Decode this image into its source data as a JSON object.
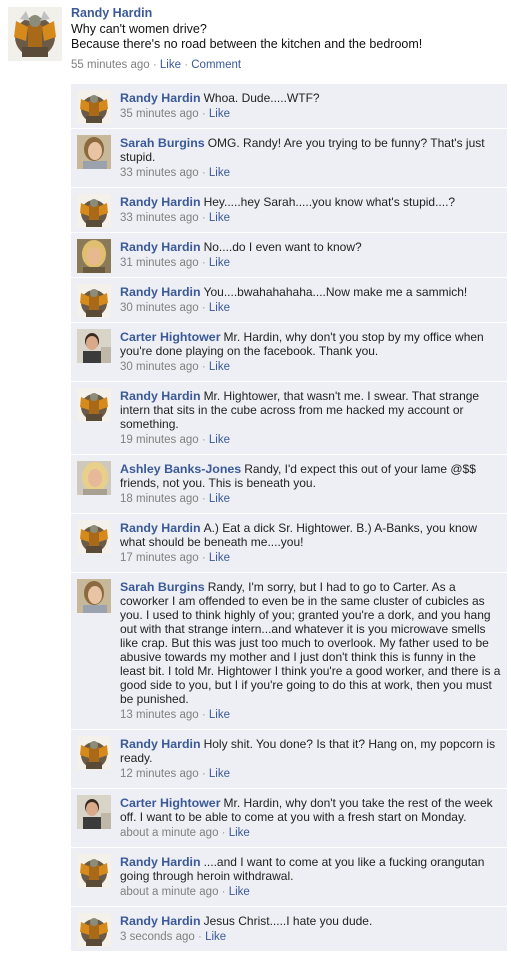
{
  "post": {
    "author": "Randy Hardin",
    "line1": "Why can't women drive?",
    "line2": "Because there's no road between the kitchen and the bedroom!",
    "time": "55 minutes ago",
    "like_label": "Like",
    "comment_label": "Comment",
    "separator": "·"
  },
  "comments": [
    {
      "author": "Randy Hardin",
      "avatar": "warrior",
      "text": "Whoa. Dude.....WTF?",
      "time": "35 minutes ago",
      "like": "Like"
    },
    {
      "author": "Sarah Burgins",
      "avatar": "sarah",
      "text": "OMG. Randy! Are you trying to be funny? That's just stupid.",
      "time": "33 minutes ago",
      "like": "Like"
    },
    {
      "author": "Randy Hardin",
      "avatar": "warrior",
      "text": "Hey.....hey Sarah.....you know what's stupid....?",
      "time": "33 minutes ago",
      "like": "Like"
    },
    {
      "author": "Randy Hardin",
      "avatar": "blonde",
      "text": "No....do I even want to know?",
      "time": "31 minutes ago",
      "like": "Like"
    },
    {
      "author": "Randy Hardin",
      "avatar": "warrior",
      "text": "You....bwahahahaha....Now make me a sammich!",
      "time": "30 minutes ago",
      "like": "Like"
    },
    {
      "author": "Carter Hightower",
      "avatar": "carter",
      "text": "Mr. Hardin, why don't you stop by my office when you're done playing on the facebook. Thank you.",
      "time": "30 minutes ago",
      "like": "Like"
    },
    {
      "author": "Randy Hardin",
      "avatar": "warrior",
      "text": "Mr. Hightower, that wasn't me. I swear. That strange intern that sits in the cube across from me hacked my account or something.",
      "time": "19 minutes ago",
      "like": "Like"
    },
    {
      "author": "Ashley Banks-Jones",
      "avatar": "ashley",
      "text": "Randy, I'd expect this out of your lame @$$ friends, not you. This is beneath you.",
      "time": "18 minutes ago",
      "like": "Like"
    },
    {
      "author": "Randy Hardin",
      "avatar": "warrior",
      "text": "A.) Eat a dick Sr. Hightower. B.) A-Banks, you know what should be beneath me....you!",
      "time": "17 minutes ago",
      "like": "Like"
    },
    {
      "author": "Sarah Burgins",
      "avatar": "sarah",
      "text": "Randy, I'm sorry, but I had to go to Carter. As a coworker I am offended to even be in the same cluster of cubicles as you. I used to think highly of you; granted you're a dork, and you hang out with that strange intern...and whatever it is you microwave smells like crap. But this was just too much to overlook. My father used to be abusive towards my mother and I just don't think this is funny in the least bit. I told Mr. Hightower I think you're a good worker, and there is a good side to you, but I if you're going to do this at work, then you must be punished.",
      "time": "13 minutes ago",
      "like": "Like"
    },
    {
      "author": "Randy Hardin",
      "avatar": "warrior",
      "text": "Holy shit. You done? Is that it? Hang on, my popcorn is ready.",
      "time": "12 minutes ago",
      "like": "Like"
    },
    {
      "author": "Carter Hightower",
      "avatar": "carter",
      "text": "Mr. Hardin, why don't you take the rest of the week off. I want to be able to come at you with a fresh start on Monday.",
      "time": "about a minute ago",
      "like": "Like"
    },
    {
      "author": "Randy Hardin",
      "avatar": "warrior",
      "text": "....and I want to come at you like a fucking orangutan going through heroin withdrawal.",
      "time": "about a minute ago",
      "like": "Like"
    },
    {
      "author": "Randy Hardin",
      "avatar": "warrior",
      "text": "Jesus Christ.....I hate you dude.",
      "time": "3 seconds ago",
      "like": "Like"
    }
  ],
  "colors": {
    "link": "#3b5998",
    "meta": "#808080",
    "comment_bg": "#edeff4"
  }
}
